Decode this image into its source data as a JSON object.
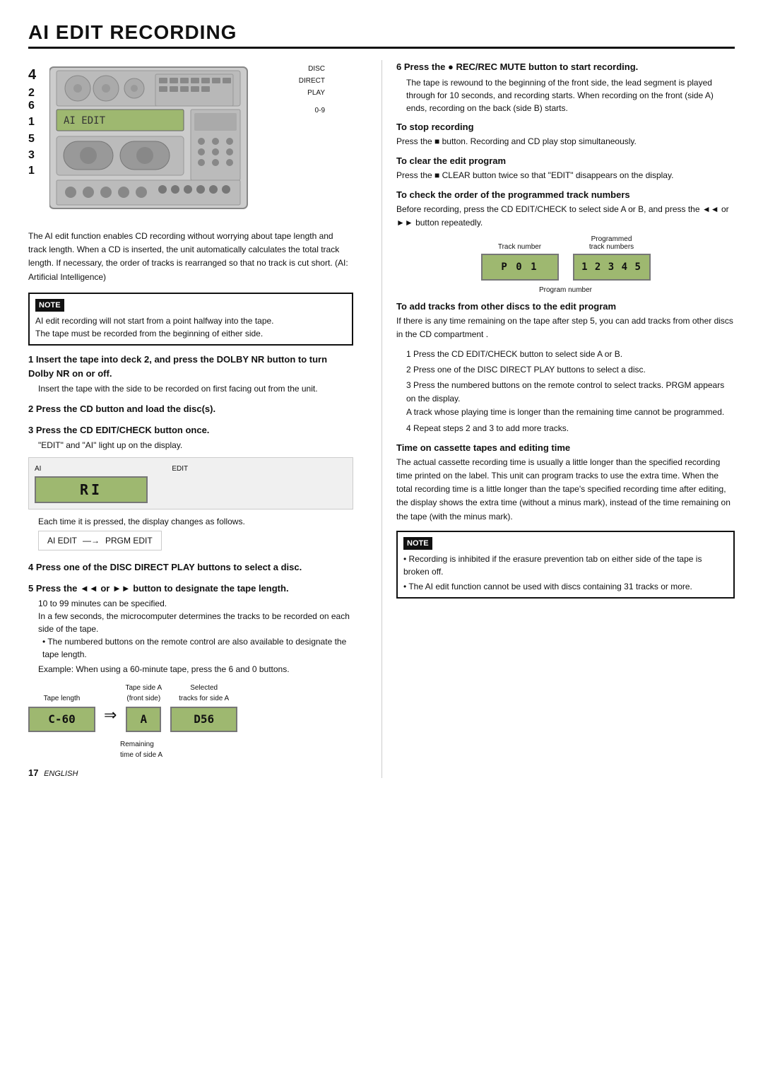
{
  "page": {
    "title": "AI EDIT RECORDING",
    "page_number": "17",
    "language": "ENGLISH"
  },
  "diagram": {
    "labels": [
      "DISC",
      "DIRECT",
      "PLAY",
      "0-9"
    ],
    "numbers": [
      "4",
      "2",
      "6",
      "1",
      "5",
      "3",
      "1"
    ]
  },
  "intro": {
    "text": "The AI edit function enables CD recording without worrying about tape length and track length. When a CD is inserted, the unit automatically calculates the total track length. If necessary, the order of tracks is rearranged so that no track is cut short. (AI: Artificial Intelligence)"
  },
  "note1": {
    "label": "NOTE",
    "lines": [
      "AI edit recording will not start from a point halfway into the tape.",
      "The tape must be recorded from the beginning of either side."
    ]
  },
  "steps": {
    "step1": {
      "header": "1  Insert the tape into deck 2, and press the DOLBY NR button to turn Dolby NR on or off.",
      "body": "Insert the tape with the side to be recorded on first facing out from the unit."
    },
    "step2": {
      "header": "2  Press the CD button and load the disc(s)."
    },
    "step3": {
      "header": "3  Press the CD EDIT/CHECK button once.",
      "body": "\"EDIT\" and \"AI\" light up on the display."
    },
    "step3_diagram_labels": [
      "AI",
      "EDIT"
    ],
    "step3_display": "RI",
    "step3_flow_left": "AI EDIT",
    "step3_flow_right": "PRGM EDIT",
    "step3_flow_note": "Each time it is pressed, the display changes as follows.",
    "step4": {
      "header": "4  Press one of the DISC DIRECT PLAY buttons to select a disc."
    },
    "step5": {
      "header": "5  Press the ◄◄ or ►► button to designate the tape length.",
      "body1": "10 to 99 minutes can be specified.",
      "body2": "In a few seconds, the microcomputer determines the tracks to be recorded on each side of the tape.",
      "bullet1": "• The numbered buttons on the remote control are also available to designate the tape length.",
      "body3": "Example: When using a 60-minute tape, press the 6 and 0 buttons.",
      "tape_label1": "Tape length",
      "tape_label2": "Tape side A\n(front side)",
      "tape_label3": "Selected\ntracks for side A",
      "tape_display1": "C-60",
      "tape_display2": "A",
      "tape_display3": "D56",
      "tape_remaining": "Remaining\ntime of side A"
    }
  },
  "right_col": {
    "step6": {
      "header": "6  Press the ● REC/REC MUTE button to start recording.",
      "body": "The tape is rewound to the beginning of the front side, the lead segment is played through for 10 seconds, and recording starts. When recording on the front (side A) ends, recording on the back (side B) starts."
    },
    "to_stop": {
      "header": "To stop recording",
      "body": "Press the ■ button. Recording and CD play stop simultaneously."
    },
    "to_clear": {
      "header": "To clear the edit program",
      "body": "Press the ■ CLEAR button twice so that \"EDIT\" disappears on the display."
    },
    "to_check": {
      "header": "To check the order of the programmed track numbers",
      "body": "Before recording, press the CD EDIT/CHECK to select side A or B, and press the ◄◄ or ►► button repeatedly.",
      "label1": "Track number",
      "label2": "Programmed\ntrack numbers",
      "label3": "Program number",
      "display1": "P 0 1",
      "display2": "1 2 3 4 5"
    },
    "to_add": {
      "header": "To add tracks from other discs to the edit program",
      "intro": "If there is any time remaining on the tape after step 5, you can add tracks from other discs in the CD compartment .",
      "items": [
        "1  Press the CD EDIT/CHECK button to select side A or B.",
        "2  Press one of the DISC DIRECT PLAY buttons to select a disc.",
        "3  Press the numbered buttons on the remote control to select tracks. PRGM  appears on the display.\n   A track whose playing time is longer than the remaining time cannot be programmed.",
        "4  Repeat steps 2 and 3 to add more tracks."
      ]
    },
    "time_section": {
      "header": "Time on cassette tapes and editing time",
      "body": "The actual cassette recording time is usually a little longer than the specified recording time printed on the label. This unit can program tracks to use the extra time. When the total recording time is a little longer than the tape's specified recording time after editing, the display shows the extra time (without a minus mark), instead of the time remaining on the tape (with the minus mark)."
    },
    "note2": {
      "label": "NOTE",
      "bullets": [
        "• Recording is inhibited if the erasure prevention tab on either side of the tape is broken off.",
        "• The AI edit function cannot be used with discs containing 31 tracks or more."
      ]
    }
  }
}
